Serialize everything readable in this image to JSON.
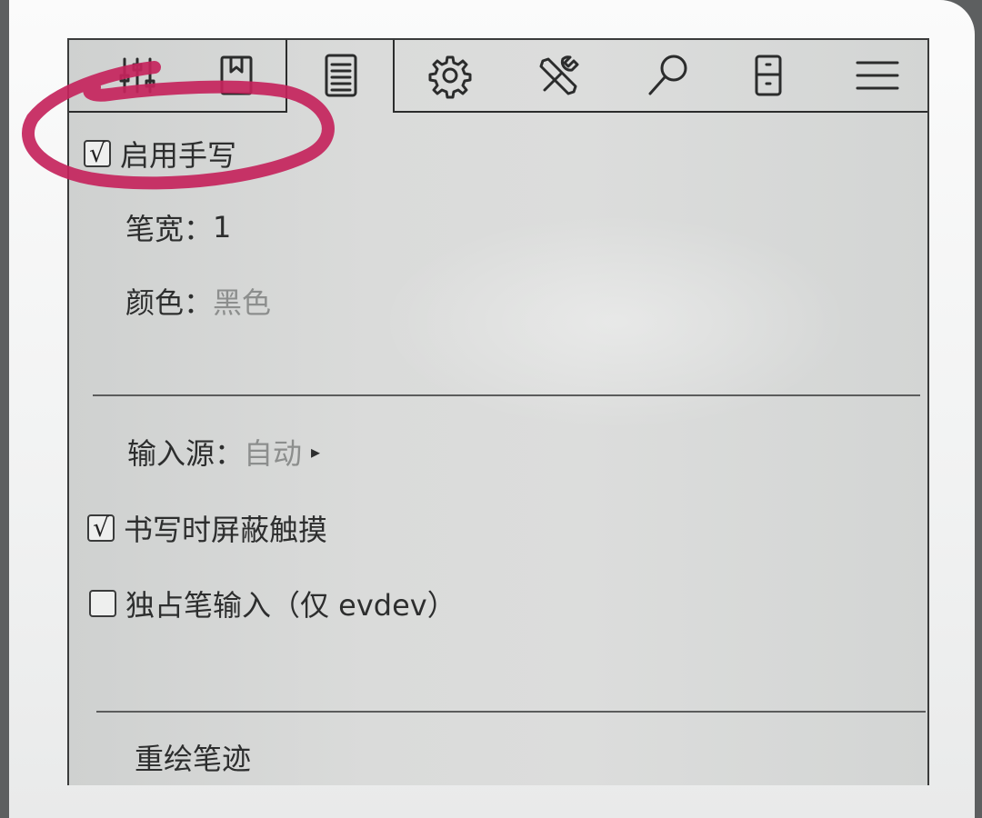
{
  "tabs": [
    {
      "icon": "sliders-icon"
    },
    {
      "icon": "bookmark-icon"
    },
    {
      "icon": "document-icon",
      "active": true
    },
    {
      "icon": "gear-icon"
    },
    {
      "icon": "tools-icon"
    },
    {
      "icon": "search-icon"
    },
    {
      "icon": "device-icon"
    },
    {
      "icon": "menu-icon"
    }
  ],
  "settings": {
    "enable_handwriting": {
      "label": "启用手写",
      "checked": true
    },
    "pen_width": {
      "label": "笔宽：",
      "value": "1"
    },
    "color": {
      "label": "颜色：",
      "value": "黑色"
    },
    "input_source": {
      "label": "输入源：",
      "value": "自动",
      "arrow": "▸"
    },
    "block_touch": {
      "label": "书写时屏蔽触摸",
      "checked": true
    },
    "exclusive_pen": {
      "label": "独占笔输入（仅 evdev）",
      "checked": false
    },
    "redraw_strokes": {
      "label": "重绘笔迹"
    }
  },
  "check_mark": "√",
  "colors": {
    "annotation": "#c4245c",
    "ink": "#2d2e2e",
    "screen": "#d8d9d8"
  }
}
